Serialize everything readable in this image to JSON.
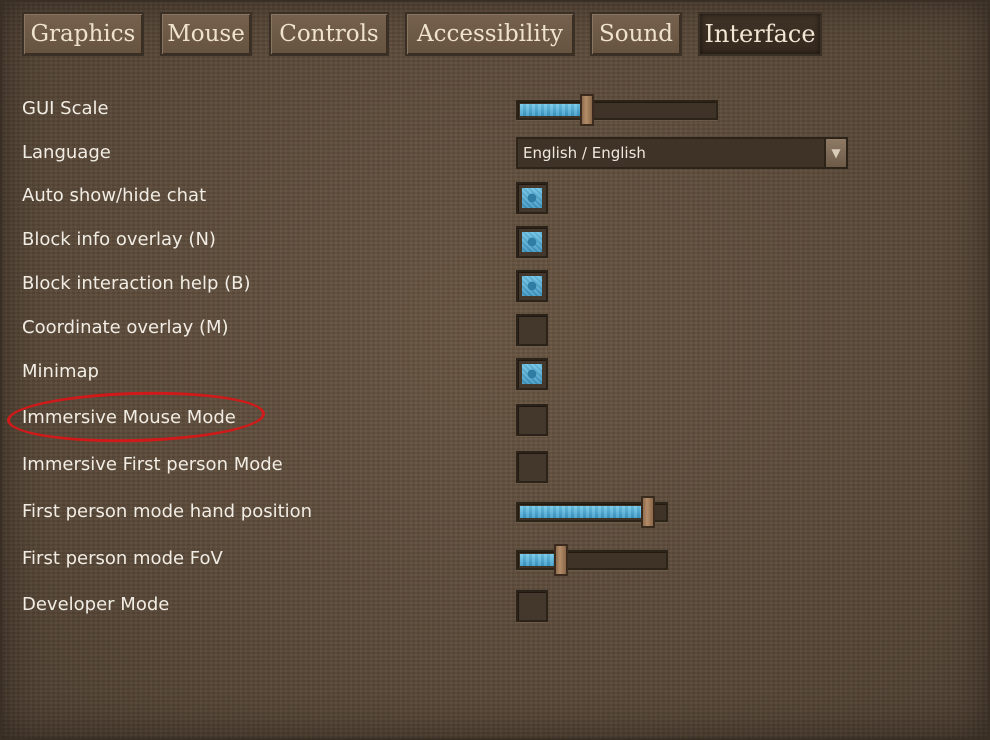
{
  "tabs": [
    "Graphics",
    "Mouse",
    "Controls",
    "Accessibility",
    "Sound",
    "Interface"
  ],
  "active_tab": "Interface",
  "settings": {
    "gui_scale": {
      "label": "GUI Scale",
      "level": 0.35
    },
    "language": {
      "label": "Language",
      "value": "English / English"
    },
    "auto_chat": {
      "label": "Auto show/hide chat",
      "checked": true
    },
    "block_info": {
      "label": "Block info overlay (N)",
      "checked": true
    },
    "block_help": {
      "label": "Block interaction help (B)",
      "checked": true
    },
    "coord_overlay": {
      "label": "Coordinate overlay (M)",
      "checked": false
    },
    "minimap": {
      "label": "Minimap",
      "checked": true
    },
    "immersive_mouse": {
      "label": "Immersive Mouse Mode",
      "checked": false
    },
    "immersive_fp": {
      "label": "Immersive First person Mode",
      "checked": false
    },
    "hand_position": {
      "label": "First person mode hand position",
      "level": 0.88
    },
    "fp_fov": {
      "label": "First person mode FoV",
      "level": 0.29
    },
    "dev_mode": {
      "label": "Developer Mode",
      "checked": false
    }
  },
  "colors": {
    "highlight": "#d01a1a",
    "accent": "#4aa8d4",
    "background": "#5d4c3b"
  },
  "icons": {
    "dropdown": "chevron-down-icon"
  }
}
